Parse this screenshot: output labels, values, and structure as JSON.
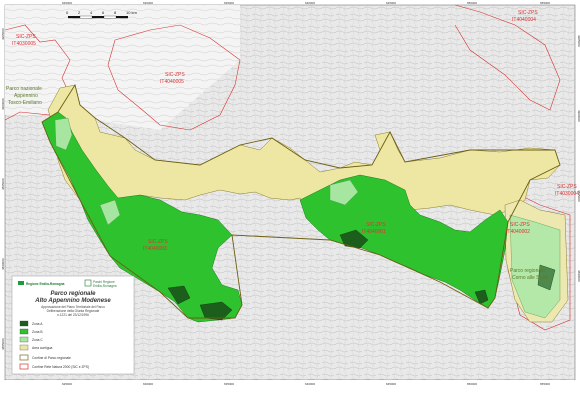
{
  "map": {
    "scale_bar": {
      "labels": [
        "0",
        "2",
        "4",
        "6",
        "8",
        "10 km"
      ]
    },
    "ticks": {
      "top": [
        "625000",
        "630000",
        "635000",
        "640000",
        "645000",
        "650000",
        "655000"
      ],
      "left": [
        "4905000",
        "4900000",
        "4895000",
        "4890000",
        "4885000"
      ],
      "right": [
        "4905000",
        "4900000",
        "4895000",
        "4890000"
      ],
      "bottom": [
        "625000",
        "630000",
        "635000",
        "640000",
        "645000",
        "650000",
        "655000"
      ]
    },
    "site_labels": [
      {
        "line1": "SIC-ZPS",
        "line2": "IT4030005"
      },
      {
        "line1": "SIC-ZPS",
        "line2": "IT4040005"
      },
      {
        "line1": "SIC-ZPS",
        "line2": "IT4040004"
      },
      {
        "line1": "SIC-ZPS",
        "line2": "IT4040003"
      },
      {
        "line1": "SIC-ZPS",
        "line2": "IT4040001"
      },
      {
        "line1": "SIC-ZPS",
        "line2": "IT4040002"
      },
      {
        "line1": "SIC-ZPS",
        "line2": "IT4030004"
      }
    ],
    "park_labels": [
      {
        "line1": "Parco nazionale",
        "line2": "Appennino",
        "line3": "Tosco-Emiliano"
      },
      {
        "line1": "Parco regionale",
        "line2": "Corno alle Scale",
        "line3": ""
      }
    ]
  },
  "legend": {
    "logo_left": "Regione Emilia-Romagna",
    "logo_right_1": "Parchi Regione",
    "logo_right_2": "Emilia-Romagna",
    "title_1": "Parco regionale",
    "title_2": "Alto Appennino Modenese",
    "subtitle_lines": [
      "Approvazione del Piano Territoriale del Parco",
      "Deliberazione della Giunta Regionale",
      "n.1221 del 23/12/1996"
    ],
    "items": [
      {
        "label": "Zona A",
        "color": "#1c5e1c"
      },
      {
        "label": "Zona B",
        "color": "#2ec32e"
      },
      {
        "label": "Zona C",
        "color": "#a7e6a0"
      },
      {
        "label": "Area contigua",
        "color": "#eee7a3"
      },
      {
        "label": "Confine di Parco regionale",
        "color": "#7a6a1a"
      },
      {
        "label": "Confine Rete Natura 2000 (SIC e ZPS)",
        "color": "#d33333"
      }
    ]
  },
  "colors": {
    "zona_a": "#1c5e1c",
    "zona_b": "#2ec32e",
    "zona_c": "#a7e6a0",
    "area_contigua": "#eee7a3",
    "natura_boundary": "#d33333",
    "terrain": "#cfcfcf"
  }
}
